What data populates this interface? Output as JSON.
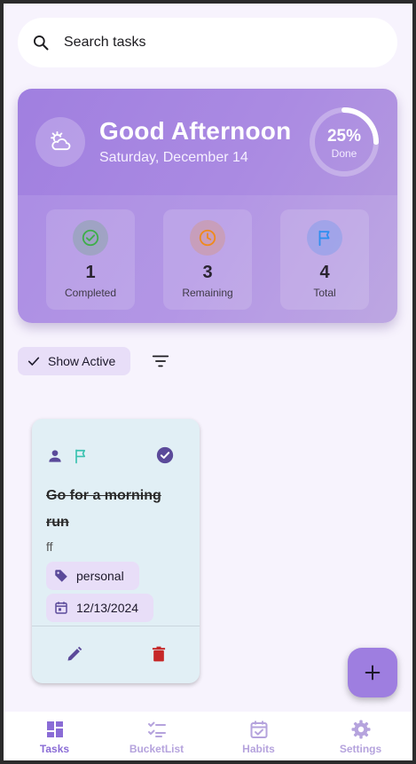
{
  "search": {
    "placeholder": "Search tasks"
  },
  "header": {
    "greeting": "Good Afternoon",
    "date": "Saturday, December 14",
    "progress_percent": 25,
    "progress_label": "25%",
    "progress_caption": "Done"
  },
  "stats": [
    {
      "value": "1",
      "label": "Completed",
      "color": "#3fae4a"
    },
    {
      "value": "3",
      "label": "Remaining",
      "color": "#f08a1c"
    },
    {
      "value": "4",
      "label": "Total",
      "color": "#2f8ff0"
    }
  ],
  "filter": {
    "chip_label": "Show Active"
  },
  "task": {
    "title": "Go for a morning run",
    "description": "ff",
    "category": "personal",
    "due_date": "12/13/2024",
    "completed": true
  },
  "colors": {
    "accent": "#9e7ee0",
    "card_bg": "#e1eff5",
    "delete": "#c62828",
    "icon": "#5b4a9a"
  },
  "nav": [
    {
      "label": "Tasks",
      "icon": "dashboard-icon"
    },
    {
      "label": "BucketList",
      "icon": "checklist-icon"
    },
    {
      "label": "Habits",
      "icon": "calendar-check-icon"
    },
    {
      "label": "Settings",
      "icon": "gear-icon"
    }
  ]
}
